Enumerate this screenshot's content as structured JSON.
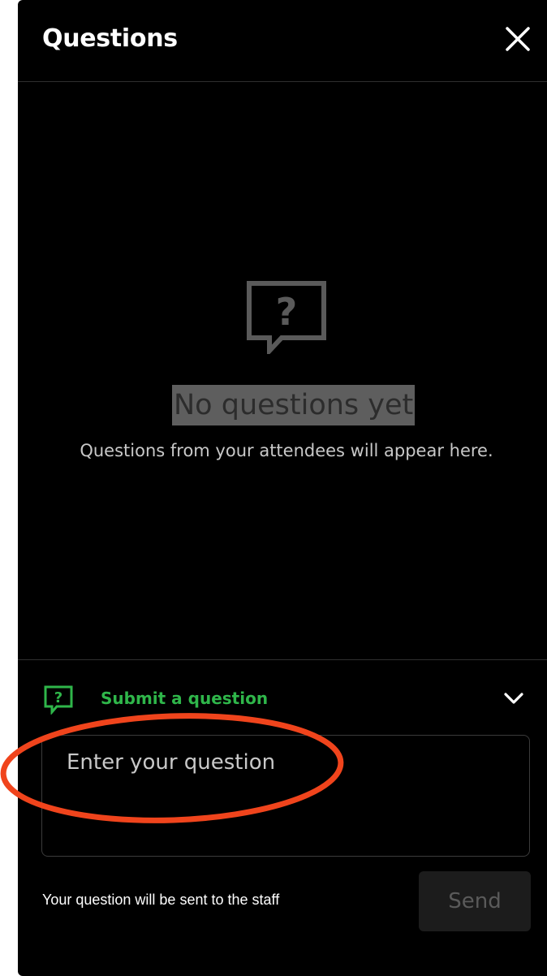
{
  "header": {
    "title": "Questions",
    "close_icon": "close-icon"
  },
  "empty_state": {
    "icon": "question-bubble-icon",
    "title": "No questions yet",
    "subtitle": "Questions from your attendees will appear here."
  },
  "submit": {
    "icon": "question-bubble-icon",
    "label": "Submit a question",
    "toggle_icon": "chevron-down-icon",
    "input_placeholder": "Enter your question",
    "input_value": "",
    "note": "Your question will be sent to the staff",
    "send_label": "Send"
  },
  "colors": {
    "background": "#000000",
    "accent_green": "#2fb64a",
    "annotation_red": "#f0441c",
    "muted_icon": "#5a5a5a",
    "send_disabled_bg": "#1c1c1c"
  }
}
